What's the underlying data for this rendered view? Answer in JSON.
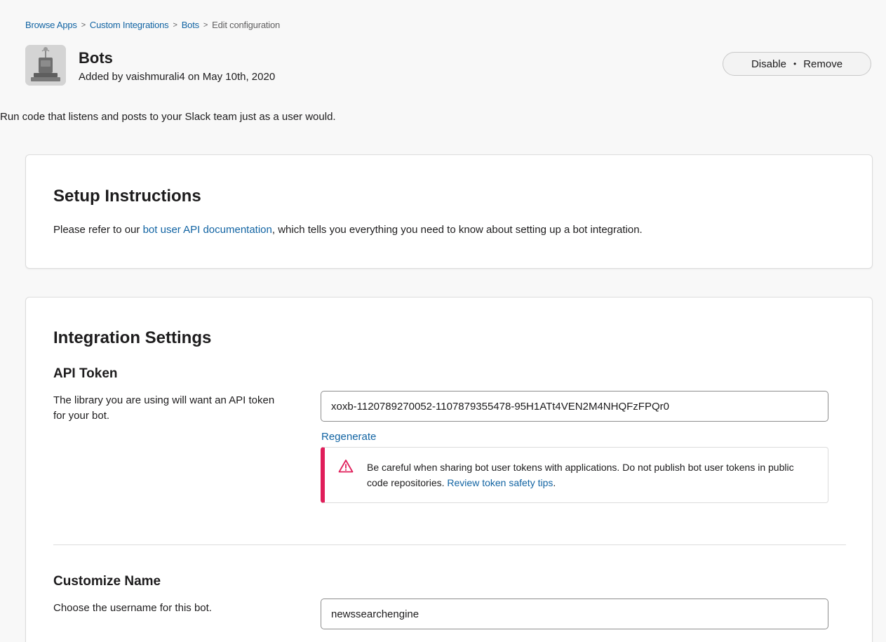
{
  "breadcrumb": {
    "items": [
      "Browse Apps",
      "Custom Integrations",
      "Bots"
    ],
    "current": "Edit configuration",
    "separator": ">"
  },
  "app": {
    "icon": "robot-icon",
    "title": "Bots",
    "subtitle": "Added by vaishmurali4 on May 10th, 2020"
  },
  "actions": {
    "disable_label": "Disable",
    "separator": "•",
    "remove_label": "Remove"
  },
  "description": "Run code that listens and posts to your Slack team just as a user would.",
  "setup": {
    "heading": "Setup Instructions",
    "text_before": "Please refer to our ",
    "link_text": "bot user API documentation",
    "text_after": ", which tells you everything you need to know about setting up a bot integration."
  },
  "settings": {
    "heading": "Integration Settings",
    "api_token": {
      "title": "API Token",
      "description": "The library you are using will want an API token for your bot.",
      "value": "xoxb-1120789270052-1107879355478-95H1ATt4VEN2M4NHQFzFPQr0",
      "regenerate_label": "Regenerate",
      "warning_icon": "warning-triangle-icon",
      "warning_text": "Be careful when sharing bot user tokens with applications. Do not publish bot user tokens in public code repositories. ",
      "warning_link": "Review token safety tips",
      "warning_end": "."
    },
    "customize_name": {
      "title": "Customize Name",
      "description": "Choose the username for this bot.",
      "value": "newssearchengine"
    }
  },
  "colors": {
    "link": "#1264a3",
    "warning_accent": "#e01e5a",
    "text": "#1d1c1d"
  }
}
